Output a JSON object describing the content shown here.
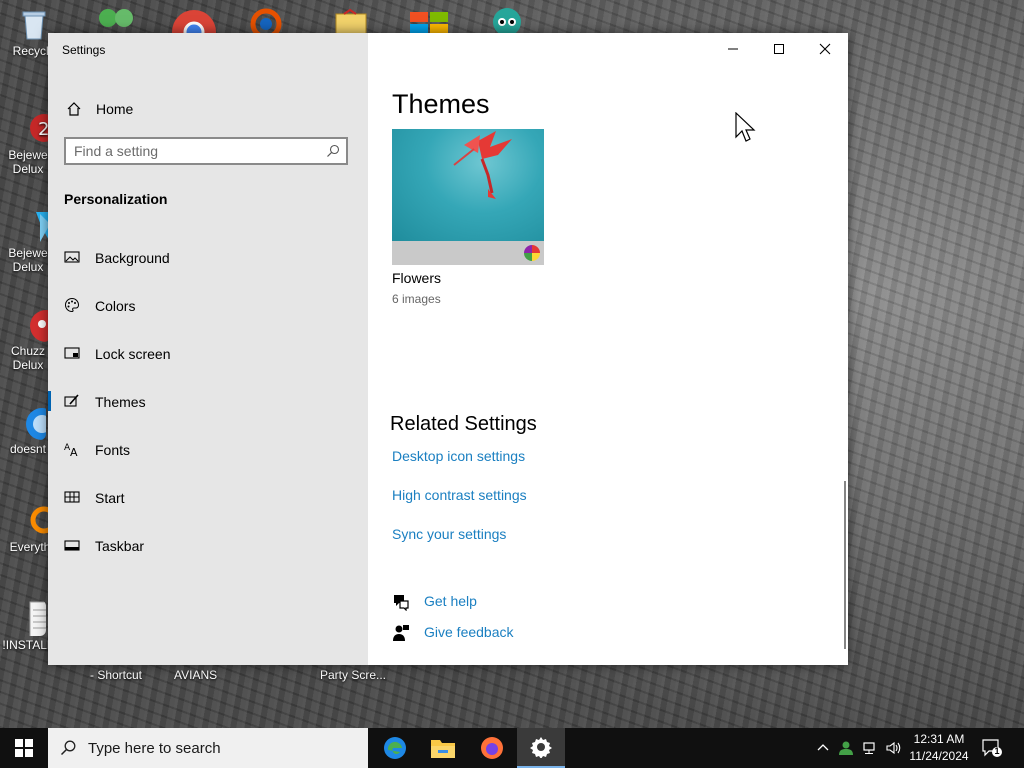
{
  "desktop": {
    "icons": [
      {
        "label": "Recycle"
      },
      {
        "label": "Bejewe\nDelux"
      },
      {
        "label": "Bejewe\nDelux"
      },
      {
        "label": "Chuzz\nDelux"
      },
      {
        "label": "doesnt"
      },
      {
        "label": "Everyth"
      },
      {
        "label": "!INSTALL"
      }
    ],
    "below_window_labels": [
      "- Shortcut",
      "AVIANS",
      "Party Scre..."
    ]
  },
  "window": {
    "title": "Settings",
    "controls": {
      "minimize": "minimize",
      "maximize": "maximize",
      "close": "close"
    }
  },
  "sidebar": {
    "home_label": "Home",
    "search_placeholder": "Find a setting",
    "section_label": "Personalization",
    "items": [
      {
        "label": "Background",
        "icon": "picture-icon",
        "active": false
      },
      {
        "label": "Colors",
        "icon": "palette-icon",
        "active": false
      },
      {
        "label": "Lock screen",
        "icon": "lock-screen-icon",
        "active": false
      },
      {
        "label": "Themes",
        "icon": "brush-icon",
        "active": true
      },
      {
        "label": "Fonts",
        "icon": "font-icon",
        "active": false
      },
      {
        "label": "Start",
        "icon": "start-icon",
        "active": false
      },
      {
        "label": "Taskbar",
        "icon": "taskbar-icon",
        "active": false
      }
    ]
  },
  "main": {
    "heading": "Themes",
    "theme": {
      "name": "Flowers",
      "count": "6 images"
    },
    "related_heading": "Related Settings",
    "related_links": [
      "Desktop icon settings",
      "High contrast settings",
      "Sync your settings"
    ],
    "help": {
      "get_help": "Get help",
      "give_feedback": "Give feedback"
    }
  },
  "taskbar": {
    "search_placeholder": "Type here to search",
    "apps": [
      "edge",
      "file-explorer",
      "firefox",
      "settings"
    ],
    "clock_time": "12:31 AM",
    "clock_date": "11/24/2024",
    "notification_count": "1"
  },
  "colors": {
    "accent": "#0063b1",
    "link": "#1a7fc1",
    "sidebar_bg": "#e6e6e6",
    "taskbar_bg": "#101010"
  }
}
